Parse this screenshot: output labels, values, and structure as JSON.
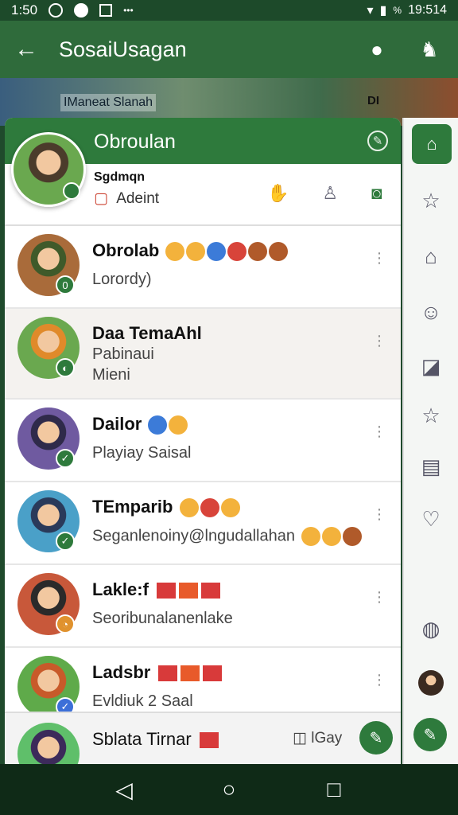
{
  "status_bar": {
    "time": "1:50",
    "right_text": "19:514",
    "battery_small": "%"
  },
  "app_bar": {
    "title": "SosaiUsagan",
    "back_icon": "arrow-left-icon",
    "actions": [
      "group-icon",
      "profile-icon"
    ]
  },
  "banner": {
    "label": "IManeat Slanah",
    "badge": "DI"
  },
  "panel": {
    "title": "Obroulan",
    "me": {
      "name": "Sgdmqn",
      "sub": "Adeint"
    }
  },
  "chats": [
    {
      "name": "Obrolab",
      "preview": "Lorordy)",
      "status": "0"
    },
    {
      "name": "Daa TemaAhl",
      "preview": "Pabinaui",
      "preview2": "Mieni"
    },
    {
      "name": "Dailor",
      "preview": "Playiay Saisal"
    },
    {
      "name": "TEmparib",
      "preview": "Seganlenoiny@lngudallahan"
    },
    {
      "name": "Lakle:f",
      "preview": "Seoribunalanenlake"
    },
    {
      "name": "Ladsbr",
      "preview": "Evldiuk 2 Saal"
    }
  ],
  "bottom": {
    "name": "Sblata Tirnar",
    "right_label": "lGay"
  },
  "nav": {
    "back": "back-triangle-icon",
    "home": "home-circle-icon",
    "recents": "recents-square-icon"
  }
}
